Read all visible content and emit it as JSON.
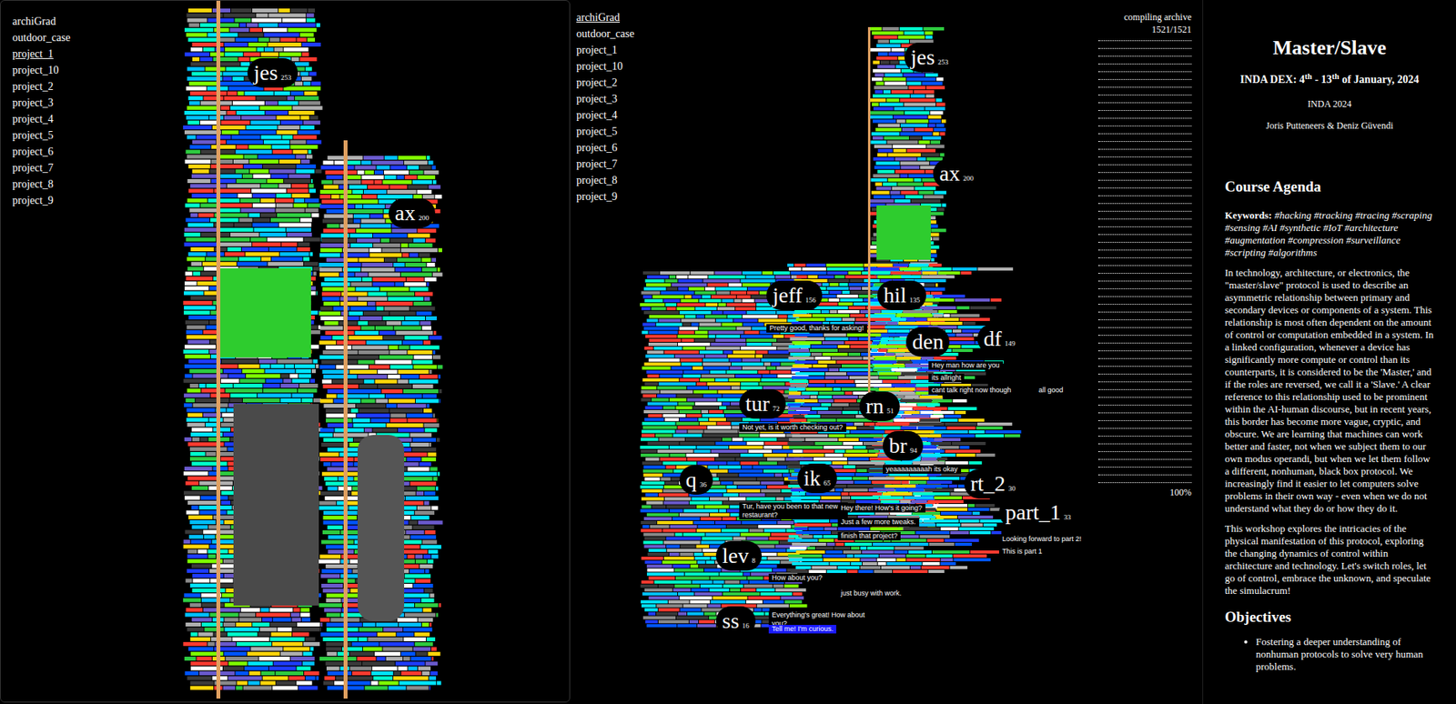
{
  "left_view": {
    "nav": [
      {
        "label": "archiGrad",
        "selected": false
      },
      {
        "label": "outdoor_case",
        "selected": false
      },
      {
        "label": "project_1",
        "selected": true
      },
      {
        "label": "project_10",
        "selected": false
      },
      {
        "label": "project_2",
        "selected": false
      },
      {
        "label": "project_3",
        "selected": false
      },
      {
        "label": "project_4",
        "selected": false
      },
      {
        "label": "project_5",
        "selected": false
      },
      {
        "label": "project_6",
        "selected": false
      },
      {
        "label": "project_7",
        "selected": false
      },
      {
        "label": "project_8",
        "selected": false
      },
      {
        "label": "project_9",
        "selected": false
      }
    ],
    "labels": [
      {
        "name": "jes",
        "count": "253"
      },
      {
        "name": "ax",
        "count": "200"
      }
    ]
  },
  "middle_view": {
    "nav": [
      {
        "label": "archiGrad",
        "selected": true
      },
      {
        "label": "outdoor_case",
        "selected": false
      },
      {
        "label": "project_1",
        "selected": false
      },
      {
        "label": "project_10",
        "selected": false
      },
      {
        "label": "project_2",
        "selected": false
      },
      {
        "label": "project_3",
        "selected": false
      },
      {
        "label": "project_4",
        "selected": false
      },
      {
        "label": "project_5",
        "selected": false
      },
      {
        "label": "project_6",
        "selected": false
      },
      {
        "label": "project_7",
        "selected": false
      },
      {
        "label": "project_8",
        "selected": false
      },
      {
        "label": "project_9",
        "selected": false
      }
    ],
    "status": {
      "title": "compiling archive",
      "progress": "1521/1521",
      "percent": "100%",
      "level": 1
    },
    "labels": [
      {
        "name": "jes",
        "count": "253"
      },
      {
        "name": "ax",
        "count": "200"
      },
      {
        "name": "jeff",
        "count": "156"
      },
      {
        "name": "hil",
        "count": "135"
      },
      {
        "name": "den"
      },
      {
        "name": "df",
        "count": "149"
      },
      {
        "name": "tur",
        "count": "72"
      },
      {
        "name": "rn",
        "count": "51"
      },
      {
        "name": "br",
        "count": "94"
      },
      {
        "name": "q",
        "count": "36"
      },
      {
        "name": "ik",
        "count": "65"
      },
      {
        "name": "rt_2",
        "count": "30"
      },
      {
        "name": "part_1",
        "count": "33"
      },
      {
        "name": "lev",
        "count": "8"
      },
      {
        "name": "ss",
        "count": "16"
      }
    ],
    "messages": [
      {
        "text": "Pretty good, thanks for asking!",
        "highlight": false
      },
      {
        "text": "Hey man how are you",
        "highlight": false
      },
      {
        "text": "its allright",
        "highlight": false
      },
      {
        "text": "cant talk right now though",
        "highlight": false
      },
      {
        "text": "all good",
        "highlight": false
      },
      {
        "text": "Not yet, is it worth checking out?",
        "highlight": false
      },
      {
        "text": "yeaaaaaaaaah its okay",
        "highlight": false
      },
      {
        "text": "Tur, have you been to that new restaurant?",
        "highlight": false
      },
      {
        "text": "Hey there! How's it going?",
        "highlight": false
      },
      {
        "text": "Just a few more tweaks.",
        "highlight": false
      },
      {
        "text": "finish that project?",
        "highlight": false
      },
      {
        "text": "Looking forward to part 2!",
        "highlight": false
      },
      {
        "text": "This is part 1",
        "highlight": false
      },
      {
        "text": "How about you?",
        "highlight": false
      },
      {
        "text": "just busy with work.",
        "highlight": false
      },
      {
        "text": "Everything's great! How about you?",
        "highlight": false
      },
      {
        "text": "Tell me! I'm curious.",
        "highlight": true
      }
    ]
  },
  "info": {
    "title": "Master/Slave",
    "dates": [
      {
        "text": "INDA DEX: 4",
        "sup": false
      },
      {
        "text": "th",
        "sup": true
      },
      {
        "text": " - 13",
        "sup": false
      },
      {
        "text": "th",
        "sup": true
      },
      {
        "text": " of January, 2024",
        "sup": false
      }
    ],
    "program": "INDA 2024",
    "authors": "Joris Putteneers & Deniz Güvendi",
    "agenda_title": "Course Agenda",
    "keywords_label": "Keywords:",
    "keywords": "#hacking #tracking #tracing #scraping #sensing #AI #synthetic #IoT #architecture #augmentation #compression #surveillance #scripting #algorithms",
    "paragraphs": [
      "In technology, architecture, or electronics, the \"master/slave\" protocol is used to describe an asymmetric relationship between primary and secondary devices or components of a system. This relationship is most often dependent on the amount of control or computation embedded in a system. In a linked configuration, whenever a device has significantly more compute or control than its counterparts, it is considered to be the 'Master,' and if the roles are reversed, we call it a 'Slave.' A clear reference to this relationship used to be prominent within the AI-human discourse, but in recent years, this border has become more vague, cryptic, and obscure. We are learning that machines can work better and faster, not when we subject them to our own modus operandi, but when we let them follow a different, nonhuman, black box protocol. We increasingly find it easier to let computers solve problems in their own way - even when we do not understand what they do or how they do it.",
      "This workshop explores the intricacies of the physical manifestation of this protocol, exploring the changing dynamics of control within architecture and technology. Let's switch roles, let go of control, embrace the unknown, and speculate the simulacrum!"
    ],
    "objectives_title": "Objectives",
    "objectives": [
      "Fostering a deeper understanding of nonhuman protocols to solve very human problems."
    ]
  }
}
